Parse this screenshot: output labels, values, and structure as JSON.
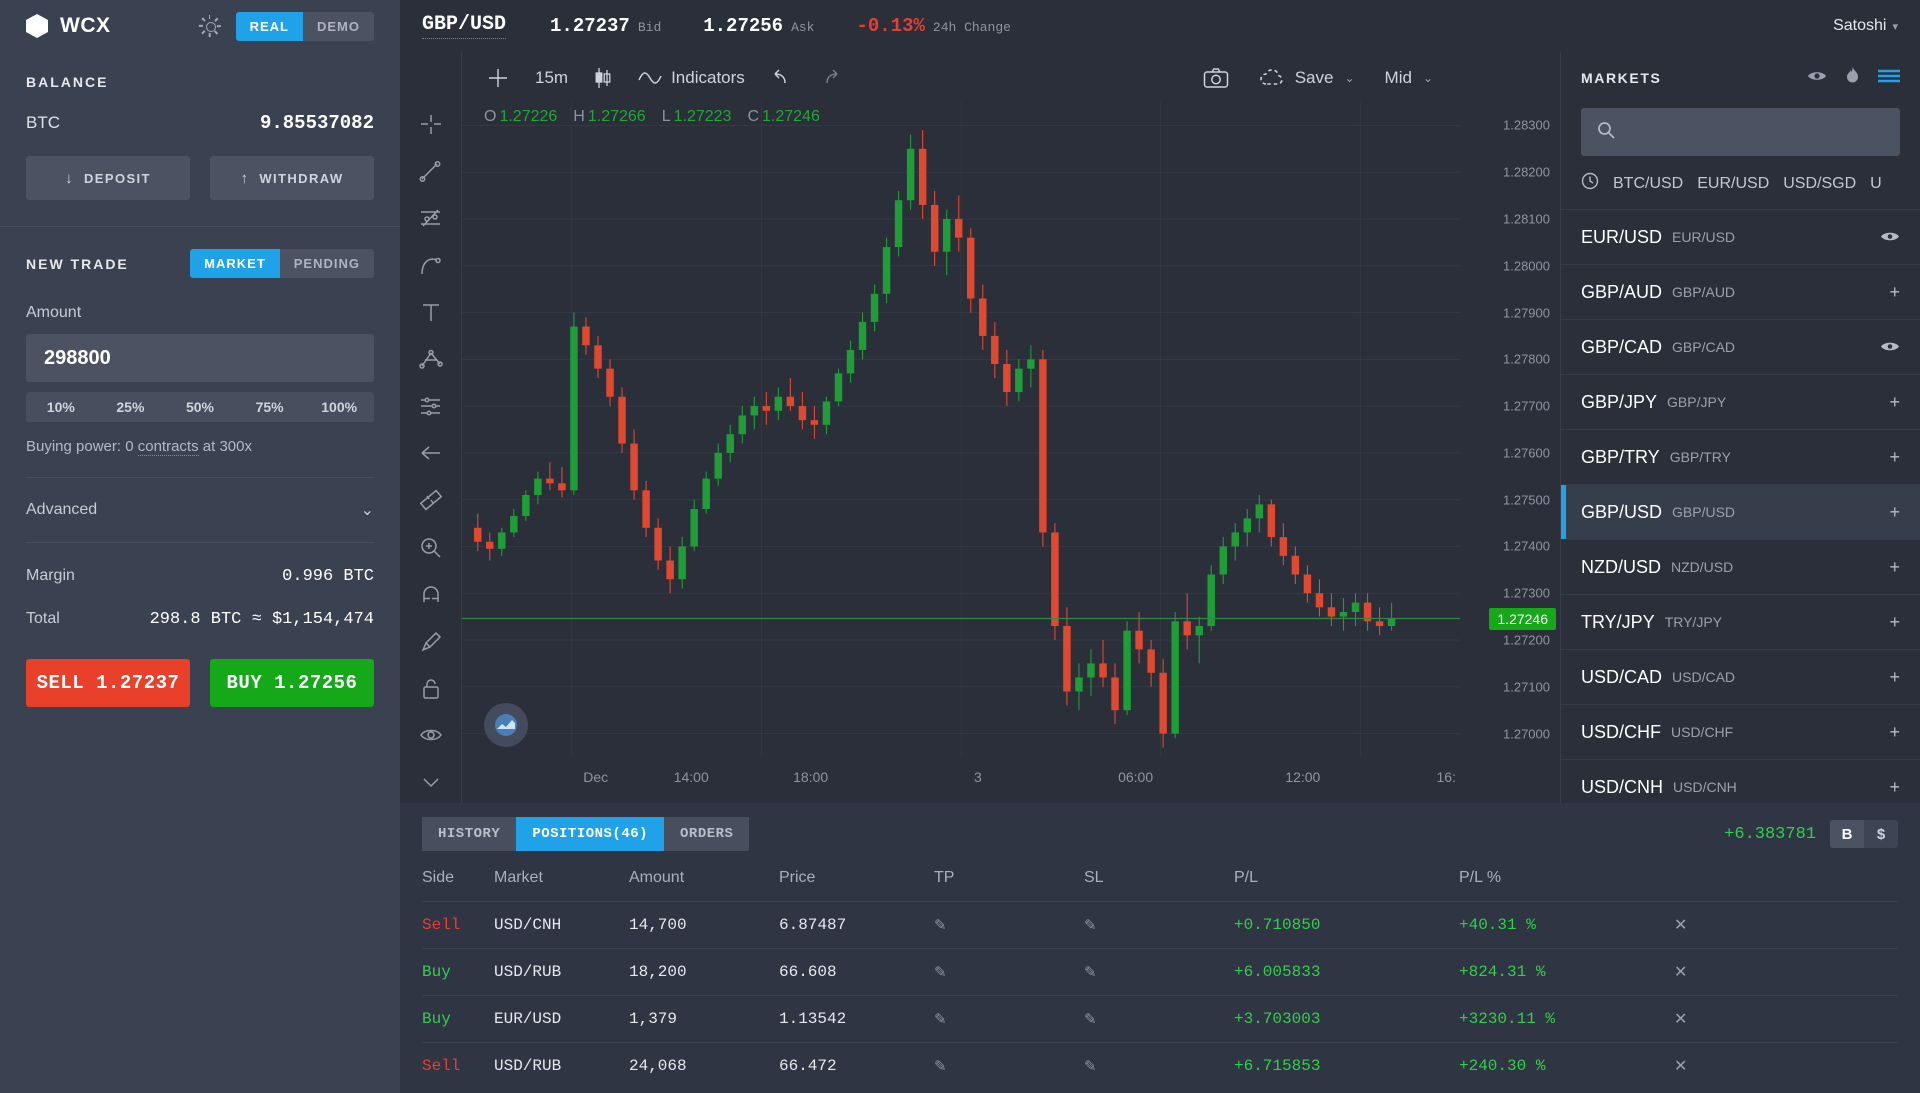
{
  "topbar": {
    "brand": "WCX",
    "theme_icon": "sun-icon",
    "mode": {
      "real": "REAL",
      "demo": "DEMO",
      "selected": "REAL"
    },
    "pair": "GBP/USD",
    "bid_value": "1.27237",
    "bid_label": "Bid",
    "ask_value": "1.27256",
    "ask_label": "Ask",
    "change_value": "-0.13%",
    "change_label": "24h Change",
    "user": "Satoshi",
    "user_caret": "▾"
  },
  "balance": {
    "title": "BALANCE",
    "currency": "BTC",
    "amount": "9.85537082",
    "deposit": "DEPOSIT",
    "deposit_arrow": "↓",
    "withdraw": "WITHDRAW",
    "withdraw_arrow": "↑"
  },
  "new_trade": {
    "title": "NEW TRADE",
    "market_tab": "MARKET",
    "pending_tab": "PENDING",
    "selected_tab": "MARKET",
    "amount_label": "Amount",
    "amount_value": "298800",
    "percents": [
      "10%",
      "25%",
      "50%",
      "75%",
      "100%"
    ],
    "buying_power_prefix": "Buying power: 0 ",
    "buying_power_link": "contracts",
    "buying_power_suffix": " at 300x",
    "advanced": "Advanced",
    "advanced_caret": "⌄",
    "margin_label": "Margin",
    "margin_value": "0.996 BTC",
    "total_label": "Total",
    "total_value": "298.8 BTC ≈ $1,154,474",
    "sell_button": "SELL 1.27237",
    "buy_button": "BUY 1.27256",
    "sell_color": "#e8402a",
    "buy_color": "#15a818"
  },
  "chart_toolbar": {
    "crosshair_icon": "crosshair-icon",
    "timeframe": "15m",
    "candles_icon": "candlestick-icon",
    "indicators_icon": "wave-icon",
    "indicators": "Indicators",
    "undo_icon": "undo-icon",
    "redo_icon": "redo-icon",
    "camera_icon": "camera-icon",
    "cloud_icon": "cloud-icon",
    "save": "Save",
    "save_caret": "⌄",
    "mid": "Mid",
    "mid_caret": "⌄"
  },
  "drawing_tools": [
    "crosshair-tool-icon",
    "trendline-icon",
    "fib-icon",
    "curve-icon",
    "text-icon",
    "pitchfork-icon",
    "gann-icon",
    "arrow-left-icon",
    "measure-icon",
    "zoom-in-icon",
    "magnet-icon",
    "brush-icon",
    "lock-icon",
    "eye-icon",
    "chevron-down-icon"
  ],
  "chart_data": {
    "type": "line",
    "title": "GBP/USD 15m",
    "ohlc": {
      "O": "1.27226",
      "H": "1.27266",
      "L": "1.27223",
      "C": "1.27246"
    },
    "ohlc_color": "#21a739",
    "ylabel": "",
    "xlabel": "",
    "ylim": [
      1.2695,
      1.2835
    ],
    "yticks": [
      "1.28300",
      "1.28200",
      "1.28100",
      "1.28000",
      "1.27900",
      "1.27800",
      "1.27700",
      "1.27600",
      "1.27500",
      "1.27400",
      "1.27300",
      "1.27200",
      "1.27100",
      "1.27000"
    ],
    "xticks": [
      "Dec",
      "14:00",
      "18:00",
      "3",
      "06:00",
      "12:00",
      "16:"
    ],
    "current_price_badge": "1.27246",
    "current_price_color": "#15a818",
    "grid": true,
    "series": [
      {
        "name": "GBP/USD",
        "candles": [
          [
            1.2744,
            1.2747,
            1.2739,
            1.2741
          ],
          [
            1.2741,
            1.2743,
            1.2737,
            1.27395
          ],
          [
            1.27395,
            1.2744,
            1.2738,
            1.2743
          ],
          [
            1.2743,
            1.2748,
            1.2742,
            1.27465
          ],
          [
            1.27465,
            1.2752,
            1.27455,
            1.2751
          ],
          [
            1.2751,
            1.2756,
            1.2749,
            1.27545
          ],
          [
            1.27545,
            1.2758,
            1.2752,
            1.27535
          ],
          [
            1.27535,
            1.2757,
            1.27505,
            1.2752
          ],
          [
            1.2752,
            1.279,
            1.2751,
            1.2787
          ],
          [
            1.2787,
            1.2789,
            1.2781,
            1.2783
          ],
          [
            1.2783,
            1.2785,
            1.2776,
            1.2778
          ],
          [
            1.2778,
            1.278,
            1.277,
            1.2772
          ],
          [
            1.2772,
            1.2774,
            1.276,
            1.2762
          ],
          [
            1.2762,
            1.2765,
            1.275,
            1.2752
          ],
          [
            1.2752,
            1.2754,
            1.2742,
            1.2744
          ],
          [
            1.2744,
            1.2746,
            1.2735,
            1.2737
          ],
          [
            1.2737,
            1.274,
            1.273,
            1.2733
          ],
          [
            1.2733,
            1.2742,
            1.2731,
            1.274
          ],
          [
            1.274,
            1.275,
            1.2739,
            1.2748
          ],
          [
            1.2748,
            1.2756,
            1.2747,
            1.27545
          ],
          [
            1.27545,
            1.2762,
            1.2753,
            1.276
          ],
          [
            1.276,
            1.2766,
            1.2758,
            1.2764
          ],
          [
            1.2764,
            1.277,
            1.2762,
            1.2768
          ],
          [
            1.2768,
            1.2772,
            1.2765,
            1.277
          ],
          [
            1.277,
            1.2773,
            1.2766,
            1.2769
          ],
          [
            1.2769,
            1.2774,
            1.2767,
            1.2772
          ],
          [
            1.2772,
            1.2776,
            1.2769,
            1.277
          ],
          [
            1.277,
            1.2773,
            1.2765,
            1.2767
          ],
          [
            1.2767,
            1.277,
            1.2763,
            1.2766
          ],
          [
            1.2766,
            1.2772,
            1.2764,
            1.2771
          ],
          [
            1.2771,
            1.2778,
            1.277,
            1.2777
          ],
          [
            1.2777,
            1.2784,
            1.2775,
            1.2782
          ],
          [
            1.2782,
            1.279,
            1.278,
            1.2788
          ],
          [
            1.2788,
            1.2796,
            1.2786,
            1.2794
          ],
          [
            1.2794,
            1.2806,
            1.2792,
            1.2804
          ],
          [
            1.2804,
            1.2816,
            1.2802,
            1.2814
          ],
          [
            1.2814,
            1.2828,
            1.2812,
            1.2825
          ],
          [
            1.2825,
            1.2829,
            1.281,
            1.2813
          ],
          [
            1.2813,
            1.2816,
            1.28,
            1.2803
          ],
          [
            1.2803,
            1.2812,
            1.2798,
            1.281
          ],
          [
            1.281,
            1.2815,
            1.2803,
            1.2806
          ],
          [
            1.2806,
            1.2808,
            1.279,
            1.2793
          ],
          [
            1.2793,
            1.2796,
            1.2782,
            1.2785
          ],
          [
            1.2785,
            1.2788,
            1.2776,
            1.2779
          ],
          [
            1.2779,
            1.2782,
            1.277,
            1.2773
          ],
          [
            1.2773,
            1.278,
            1.2771,
            1.2778
          ],
          [
            1.2778,
            1.2783,
            1.2774,
            1.278
          ],
          [
            1.278,
            1.2782,
            1.274,
            1.2743
          ],
          [
            1.2743,
            1.2745,
            1.272,
            1.2723
          ],
          [
            1.2723,
            1.2727,
            1.2706,
            1.2709
          ],
          [
            1.2709,
            1.2715,
            1.2705,
            1.2712
          ],
          [
            1.2712,
            1.2718,
            1.2708,
            1.2715
          ],
          [
            1.2715,
            1.272,
            1.271,
            1.2712
          ],
          [
            1.2712,
            1.2715,
            1.2702,
            1.2705
          ],
          [
            1.2705,
            1.2724,
            1.2704,
            1.2722
          ],
          [
            1.2722,
            1.2726,
            1.2715,
            1.2718
          ],
          [
            1.2718,
            1.272,
            1.271,
            1.2713
          ],
          [
            1.2713,
            1.2716,
            1.2697,
            1.27
          ],
          [
            1.27,
            1.2726,
            1.2699,
            1.2724
          ],
          [
            1.2724,
            1.273,
            1.2718,
            1.2721
          ],
          [
            1.2721,
            1.2725,
            1.2715,
            1.2723
          ],
          [
            1.2723,
            1.2736,
            1.2722,
            1.2734
          ],
          [
            1.2734,
            1.2742,
            1.2732,
            1.274
          ],
          [
            1.274,
            1.2745,
            1.2737,
            1.2743
          ],
          [
            1.2743,
            1.2748,
            1.274,
            1.2746
          ],
          [
            1.2746,
            1.2751,
            1.2743,
            1.2749
          ],
          [
            1.2749,
            1.275,
            1.274,
            1.2742
          ],
          [
            1.2742,
            1.2745,
            1.2736,
            1.2738
          ],
          [
            1.2738,
            1.274,
            1.2732,
            1.2734
          ],
          [
            1.2734,
            1.2736,
            1.2728,
            1.273
          ],
          [
            1.273,
            1.2733,
            1.2725,
            1.2727
          ],
          [
            1.2727,
            1.273,
            1.2723,
            1.2725
          ],
          [
            1.2725,
            1.2729,
            1.2722,
            1.2726
          ],
          [
            1.2726,
            1.273,
            1.2723,
            1.2728
          ],
          [
            1.2728,
            1.273,
            1.2722,
            1.2724
          ],
          [
            1.2724,
            1.2727,
            1.2721,
            1.2723
          ],
          [
            1.2723,
            1.2728,
            1.2722,
            1.27246
          ]
        ]
      }
    ]
  },
  "markets": {
    "title": "MARKETS",
    "eye_icon": "eye-icon",
    "fire_icon": "fire-icon",
    "menu_icon": "hamburger-icon",
    "search_placeholder": "",
    "search_icon": "search-icon",
    "recent_icon": "clock-icon",
    "recent": [
      "BTC/USD",
      "EUR/USD",
      "USD/SGD",
      "U"
    ],
    "rows": [
      {
        "symbol": "EUR/USD",
        "sub": "EUR/USD",
        "action": "eye",
        "active": false
      },
      {
        "symbol": "GBP/AUD",
        "sub": "GBP/AUD",
        "action": "plus",
        "active": false
      },
      {
        "symbol": "GBP/CAD",
        "sub": "GBP/CAD",
        "action": "eye",
        "active": false
      },
      {
        "symbol": "GBP/JPY",
        "sub": "GBP/JPY",
        "action": "plus",
        "active": false
      },
      {
        "symbol": "GBP/TRY",
        "sub": "GBP/TRY",
        "action": "plus",
        "active": false
      },
      {
        "symbol": "GBP/USD",
        "sub": "GBP/USD",
        "action": "plus",
        "active": true
      },
      {
        "symbol": "NZD/USD",
        "sub": "NZD/USD",
        "action": "plus",
        "active": false
      },
      {
        "symbol": "TRY/JPY",
        "sub": "TRY/JPY",
        "action": "plus",
        "active": false
      },
      {
        "symbol": "USD/CAD",
        "sub": "USD/CAD",
        "action": "plus",
        "active": false
      },
      {
        "symbol": "USD/CHF",
        "sub": "USD/CHF",
        "action": "plus",
        "active": false
      },
      {
        "symbol": "USD/CNH",
        "sub": "USD/CNH",
        "action": "plus",
        "active": false
      }
    ]
  },
  "positions_panel": {
    "tabs": [
      {
        "label": "ORDERS",
        "active": false
      },
      {
        "label": "POSITIONS(46)",
        "active": true
      },
      {
        "label": "HISTORY",
        "active": false
      }
    ],
    "pl_total": "+6.383781",
    "currency_toggle": [
      {
        "label": "B",
        "active": true
      },
      {
        "label": "$",
        "active": false
      }
    ],
    "columns": [
      "Side",
      "Market",
      "Amount",
      "Price",
      "TP",
      "SL",
      "P/L",
      "P/L %",
      ""
    ],
    "rows": [
      {
        "side": "Sell",
        "market": "USD/CNH",
        "amount": "14,700",
        "price": "6.87487",
        "tp": "✎",
        "sl": "✎",
        "pl": "+0.710850",
        "plpct": "+40.31 %",
        "close": "✕"
      },
      {
        "side": "Buy",
        "market": "USD/RUB",
        "amount": "18,200",
        "price": "66.608",
        "tp": "✎",
        "sl": "✎",
        "pl": "+6.005833",
        "plpct": "+824.31 %",
        "close": "✕"
      },
      {
        "side": "Buy",
        "market": "EUR/USD",
        "amount": "1,379",
        "price": "1.13542",
        "tp": "✎",
        "sl": "✎",
        "pl": "+3.703003",
        "plpct": "+3230.11 %",
        "close": "✕"
      },
      {
        "side": "Sell",
        "market": "USD/RUB",
        "amount": "24,068",
        "price": "66.472",
        "tp": "✎",
        "sl": "✎",
        "pl": "+6.715853",
        "plpct": "+240.30 %",
        "close": "✕"
      }
    ]
  },
  "colors": {
    "accent": "#1fa2e8",
    "up": "#15a818",
    "down": "#e8402a",
    "panel": "#3a4150",
    "bg": "#2a2f3a"
  }
}
